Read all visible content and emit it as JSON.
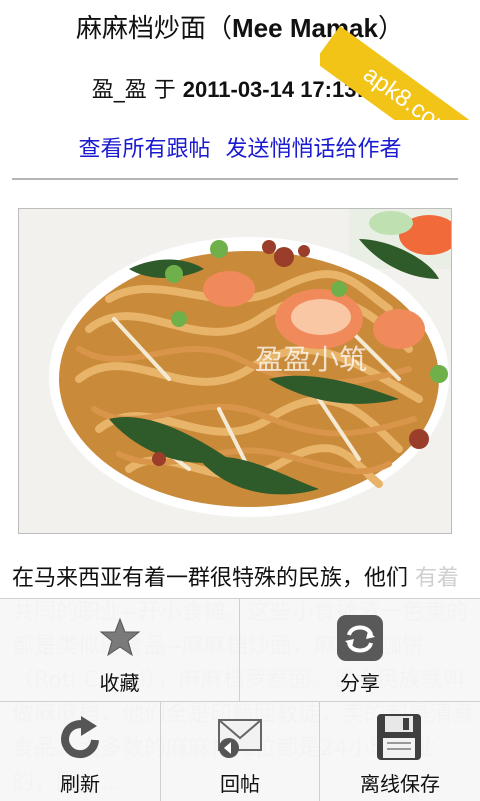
{
  "post": {
    "title_cn": "麻麻档炒面（",
    "title_en": "Mee Mamak",
    "title_end": "）",
    "author": "盈_盈",
    "author_sep": "于",
    "datetime": "2011-03-14 17:13:21",
    "link_all_replies": "查看所有跟帖",
    "link_message_author": "发送悄悄话给作者",
    "body_visible": "在马来西亚有着一群很特殊的民族，他们",
    "body_faded": "有着共同的职业--开小食摊。这些小食摊清一色卖的都是类似的食品--麻麻档炒面，麻麻档咖饼（Roti Canai），麻麻档罗惹面。这个民族就叫做麻麻档，他们全是印籍回教徒，卖的都是清真食品。大多数的麻麻档摊位都是24小时营业的，因为..."
  },
  "photo": {
    "watermark": "盈盈小筑"
  },
  "badge": {
    "text": "apk8.com"
  },
  "menu": {
    "favorite": "收藏",
    "share": "分享",
    "refresh": "刷新",
    "reply": "回帖",
    "offline_save": "离线保存"
  }
}
